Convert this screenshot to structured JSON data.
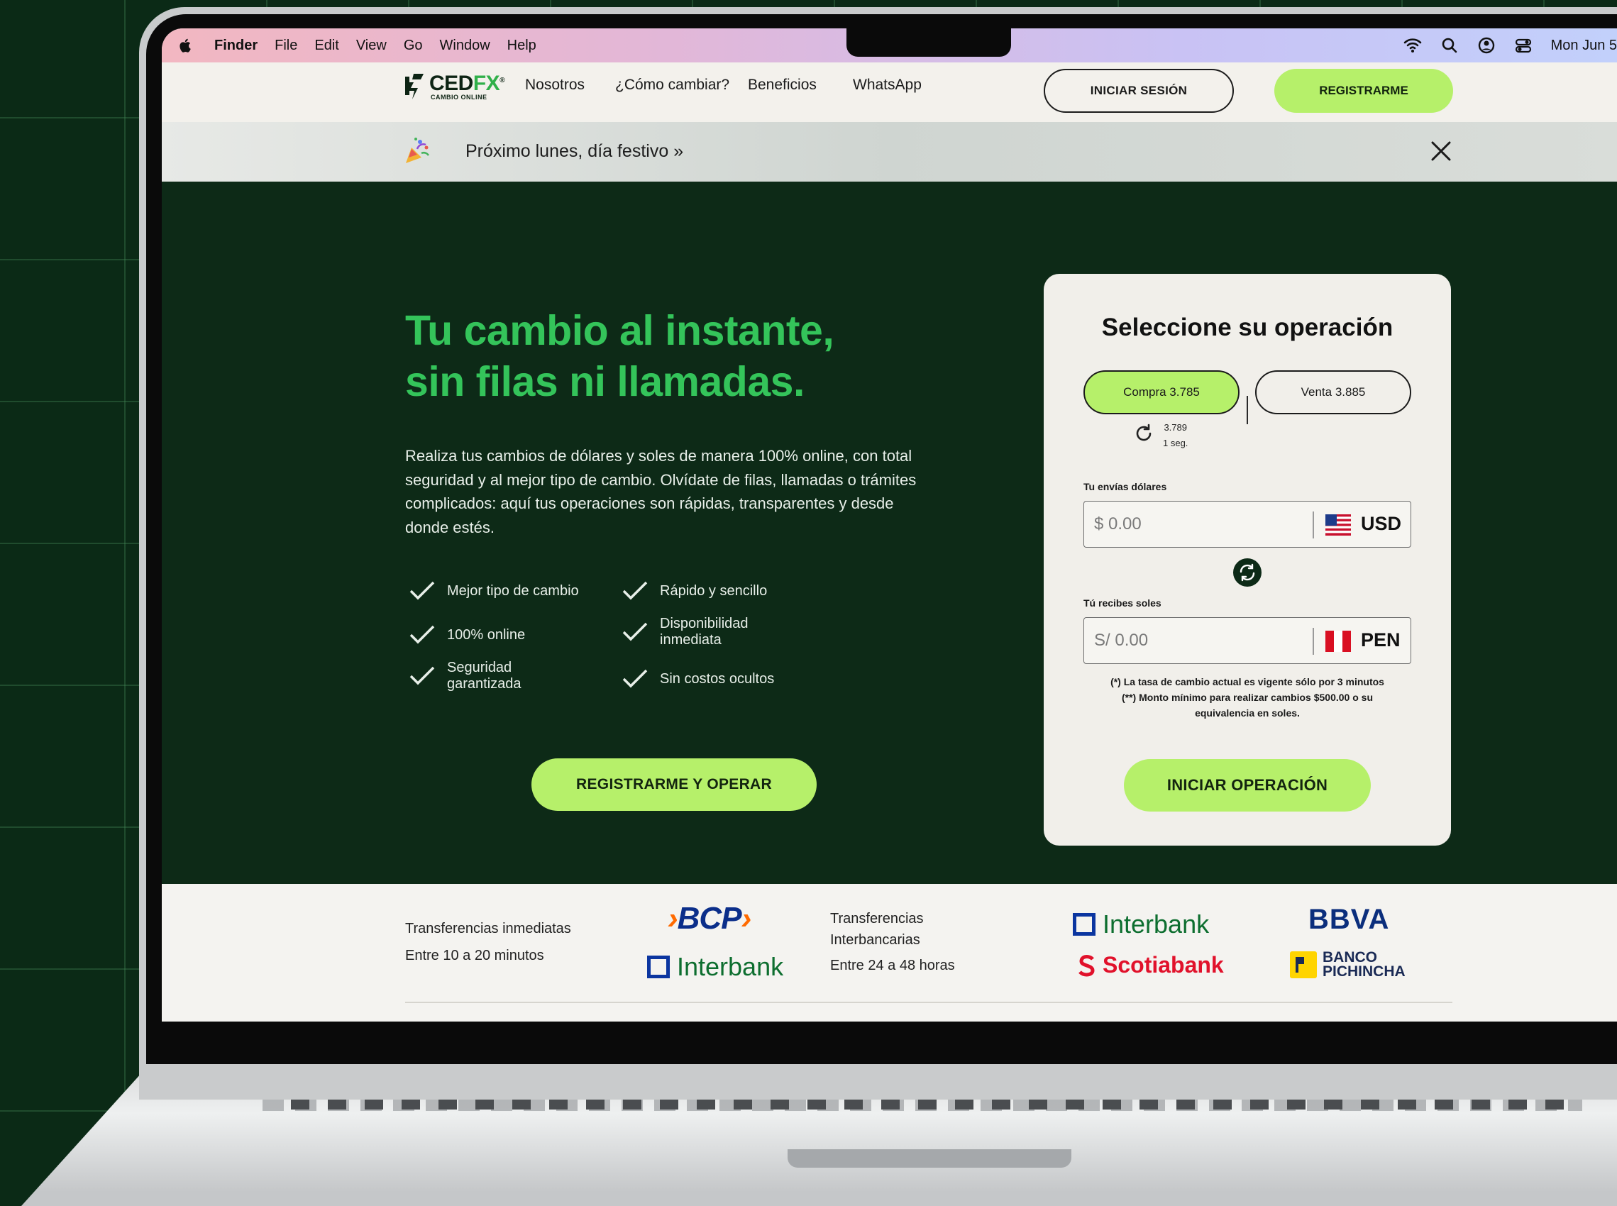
{
  "menubar": {
    "app": "Finder",
    "items": [
      "File",
      "Edit",
      "View",
      "Go",
      "Window",
      "Help"
    ],
    "clock": "Mon Jun 5"
  },
  "header": {
    "logo": {
      "brand_a": "CED",
      "brand_b": "FX",
      "tagline": "CAMBIO ONLINE"
    },
    "nav": [
      "Nosotros",
      "¿Cómo cambiar?",
      "Beneficios",
      "WhatsApp"
    ],
    "login_label": "INICIAR SESIÓN",
    "register_label": "REGISTRARME"
  },
  "announcement": {
    "text": "Próximo lunes, día festivo »"
  },
  "hero": {
    "title_line1": "Tu cambio al instante,",
    "title_line2": "sin filas ni llamadas.",
    "lead": "Realiza tus cambios de dólares y soles de manera 100% online, con total seguridad y al mejor tipo de cambio. Olvídate de filas, llamadas o trámites complicados: aquí tus operaciones son rápidas, transparentes y desde donde estés.",
    "features": [
      {
        "line1": "Mejor tipo de cambio",
        "line2": ""
      },
      {
        "line1": "Rápido y sencillo",
        "line2": ""
      },
      {
        "line1": "100% online",
        "line2": ""
      },
      {
        "line1": "Disponibilidad",
        "line2": "inmediata"
      },
      {
        "line1": "Seguridad",
        "line2": "garantizada"
      },
      {
        "line1": "Sin costos ocultos",
        "line2": ""
      }
    ],
    "cta_label": "REGISTRARME Y OPERAR"
  },
  "card": {
    "title": "Seleccione su operación",
    "buy_label": "Compra 3.785",
    "sell_label": "Venta 3.885",
    "live_rate": "3.789",
    "live_timer": "1 seg.",
    "send_label": "Tu envías dólares",
    "send_placeholder": "$ 0.00",
    "send_currency": "USD",
    "receive_label": "Tú recibes soles",
    "receive_placeholder": "S/ 0.00",
    "receive_currency": "PEN",
    "note1": "(*) La tasa de cambio actual es vigente sólo por 3 minutos",
    "note2": "(**) Monto mínimo para realizar cambios $500.00 o su",
    "note3": "equivalencia en soles.",
    "cta_label": "INICIAR OPERACIÓN"
  },
  "banks": {
    "immediate_title": "Transferencias inmediatas",
    "immediate_time": "Entre 10 a 20 minutos",
    "interbank_title1": "Transferencias",
    "interbank_title2": "Interbancarias",
    "interbank_time": "Entre 24 a 48 horas",
    "logos": {
      "bcp": "BCP",
      "interbank": "Interbank",
      "bbva": "BBVA",
      "scotiabank": "Scotiabank",
      "pichincha1": "BANCO",
      "pichincha2": "PICHINCHA"
    }
  },
  "colors": {
    "accent_green": "#b6f06a",
    "hero_bg": "#0d2a17",
    "title_green": "#34c45a"
  }
}
